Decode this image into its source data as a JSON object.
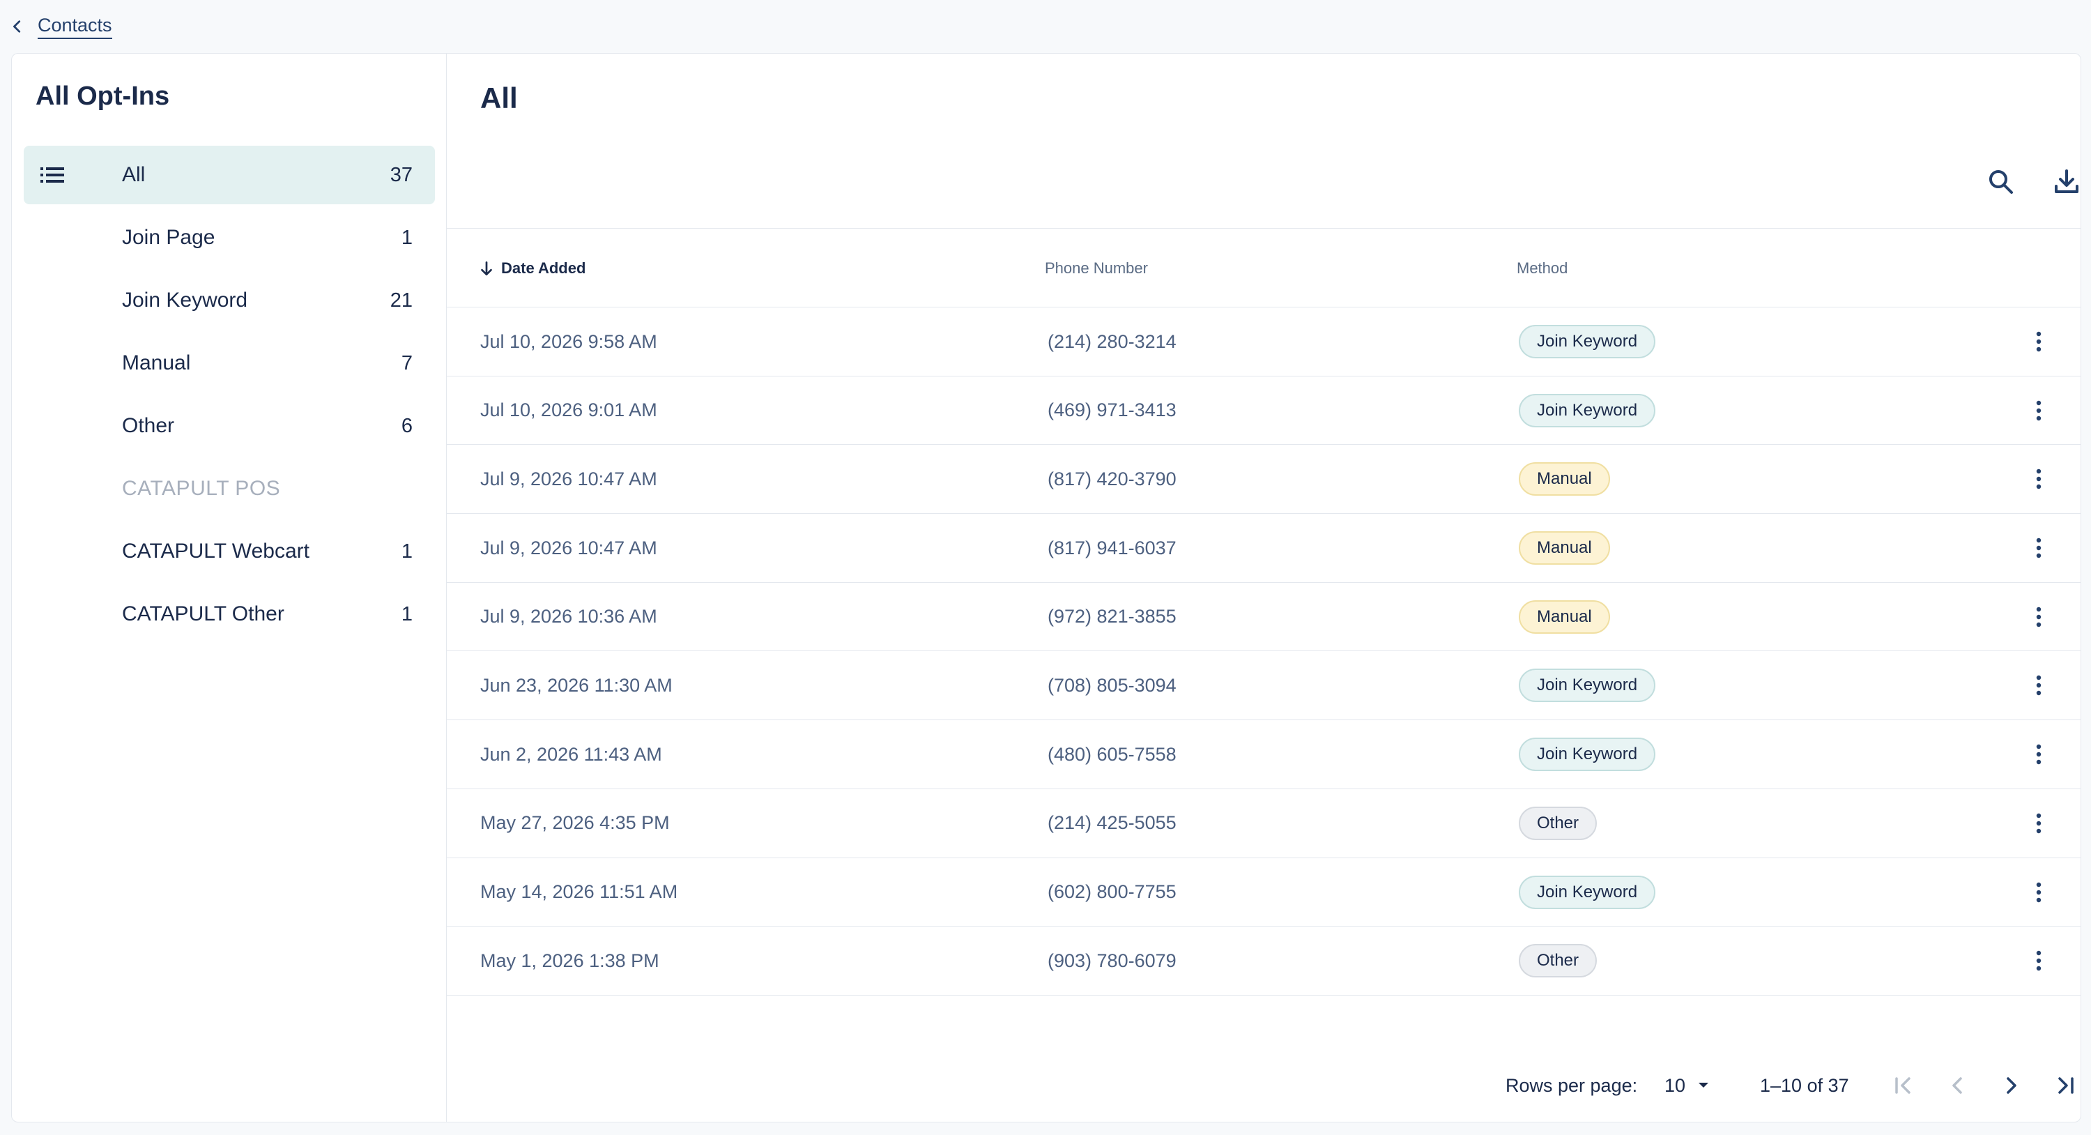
{
  "breadcrumb": {
    "back_label": "Contacts"
  },
  "sidebar": {
    "title": "All Opt-Ins",
    "items": [
      {
        "label": "All",
        "count": "37",
        "active": true
      },
      {
        "label": "Join Page",
        "count": "1"
      },
      {
        "label": "Join Keyword",
        "count": "21"
      },
      {
        "label": "Manual",
        "count": "7"
      },
      {
        "label": "Other",
        "count": "6"
      }
    ],
    "group_label": "CATAPULT POS",
    "group_items": [
      {
        "label": "CATAPULT Webcart",
        "count": "1"
      },
      {
        "label": "CATAPULT Other",
        "count": "1"
      }
    ]
  },
  "main": {
    "title": "All",
    "columns": {
      "date": "Date Added",
      "phone": "Phone Number",
      "method": "Method"
    },
    "rows": [
      {
        "date": "Jul 10, 2026 9:58 AM",
        "phone": "(214) 280-3214",
        "method": "Join Keyword",
        "type": "keyword"
      },
      {
        "date": "Jul 10, 2026 9:01 AM",
        "phone": "(469) 971-3413",
        "method": "Join Keyword",
        "type": "keyword"
      },
      {
        "date": "Jul 9, 2026 10:47 AM",
        "phone": "(817) 420-3790",
        "method": "Manual",
        "type": "manual"
      },
      {
        "date": "Jul 9, 2026 10:47 AM",
        "phone": "(817) 941-6037",
        "method": "Manual",
        "type": "manual"
      },
      {
        "date": "Jul 9, 2026 10:36 AM",
        "phone": "(972) 821-3855",
        "method": "Manual",
        "type": "manual"
      },
      {
        "date": "Jun 23, 2026 11:30 AM",
        "phone": "(708) 805-3094",
        "method": "Join Keyword",
        "type": "keyword"
      },
      {
        "date": "Jun 2, 2026 11:43 AM",
        "phone": "(480) 605-7558",
        "method": "Join Keyword",
        "type": "keyword"
      },
      {
        "date": "May 27, 2026 4:35 PM",
        "phone": "(214) 425-5055",
        "method": "Other",
        "type": "other"
      },
      {
        "date": "May 14, 2026 11:51 AM",
        "phone": "(602) 800-7755",
        "method": "Join Keyword",
        "type": "keyword"
      },
      {
        "date": "May 1, 2026 1:38 PM",
        "phone": "(903) 780-6079",
        "method": "Other",
        "type": "other"
      }
    ]
  },
  "pagination": {
    "rows_label": "Rows per page:",
    "rows_value": "10",
    "range": "1–10 of 37"
  },
  "icons": {
    "back": "chevron-left-icon",
    "list": "list-icon",
    "search": "search-icon",
    "download": "download-icon",
    "sort": "arrow-down-icon",
    "row_menu": "more-vertical-icon",
    "first": "first-page-icon",
    "prev": "chevron-left-icon",
    "next": "chevron-right-icon",
    "last": "last-page-icon"
  },
  "colors": {
    "accent": "#24406b",
    "active_bg": "#e3f1f1",
    "badge_keyword": "#e8f4f4",
    "badge_manual": "#fdf3d4",
    "badge_other": "#eef0f3"
  }
}
